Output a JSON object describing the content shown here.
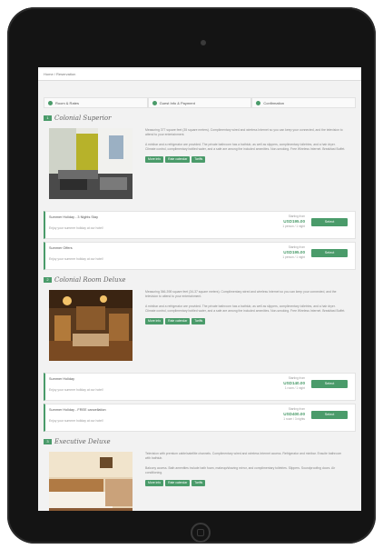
{
  "breadcrumb": "Home / Reservation",
  "steps": [
    {
      "label": "Room & Rates"
    },
    {
      "label": "Guest Info & Payment"
    },
    {
      "label": "Confirmation"
    }
  ],
  "actions": {
    "more": "More info",
    "calendar": "Rate calendar",
    "tariffs": "Tariffs"
  },
  "select_label": "Select",
  "rooms": [
    {
      "badge": "1",
      "title": "Colonial Superior",
      "desc": [
        "Measuring 377 square feet (35 square meters). Complimentary wired and wireless Internet so you can keep your connected, and the television to attend to your entertainment.",
        "A minibar and a refrigerator are provided. The private bathroom has a bathtub, as well as slippers, complimentary toiletries, and a hair dryer. Climate control, complimentary bottled water, and a safe are among the included amenities. Non-smoking. Free Wireless Internet. Breakfast Buffet."
      ],
      "rates": [
        {
          "name": "Summer Holiday - 3 Nights Stay",
          "sub": "Enjoy your summer holiday at our hotel!",
          "from": "Starting from",
          "price": "USD195.00",
          "nights": "1 person / 1 night"
        },
        {
          "name": "Summer Offers",
          "sub": "Enjoy your summer holiday at our hotel!",
          "from": "Starting from",
          "price": "USD195.00",
          "nights": "1 person / 1 night"
        }
      ]
    },
    {
      "badge": "2",
      "title": "Colonial Room Deluxe",
      "desc": [
        "Measuring 366-398 square feet (34-37 square meters). Complimentary wired and wireless Internet so you can keep your connected, and the television to attend to your entertainment.",
        "A minibar and a refrigerator are provided. The private bathroom has a bathtub, as well as slippers, complimentary toiletries, and a hair dryer. Climate control, complimentary bottled water, and a safe are among the included amenities. Non-smoking. Free Wireless Internet. Breakfast Buffet."
      ],
      "rates": [
        {
          "name": "Summer Holiday",
          "sub": "Enjoy your summer holiday at our hotel!",
          "from": "Starting from",
          "price": "USD140.00",
          "nights": "1 room / 1 night"
        },
        {
          "name": "Summer Holiday - FREE cancellation",
          "sub": "Enjoy your summer holiday at our hotel!",
          "from": "Starting from",
          "price": "USD400.00",
          "nights": "1 room / 3 nights"
        }
      ]
    },
    {
      "badge": "3",
      "title": "Executive Deluxe",
      "desc": [
        "Television with premium cable/satellite channels. Complimentary wired and wireless Internet access. Refrigerator and minibar. Ensuite bathroom with bathtub.",
        "Balcony access. Bath amenities include bath foam, makeup/shaving mirror, and complimentary toiletries. Slippers. Soundproofing doors. Air conditioning."
      ],
      "rates": []
    }
  ]
}
